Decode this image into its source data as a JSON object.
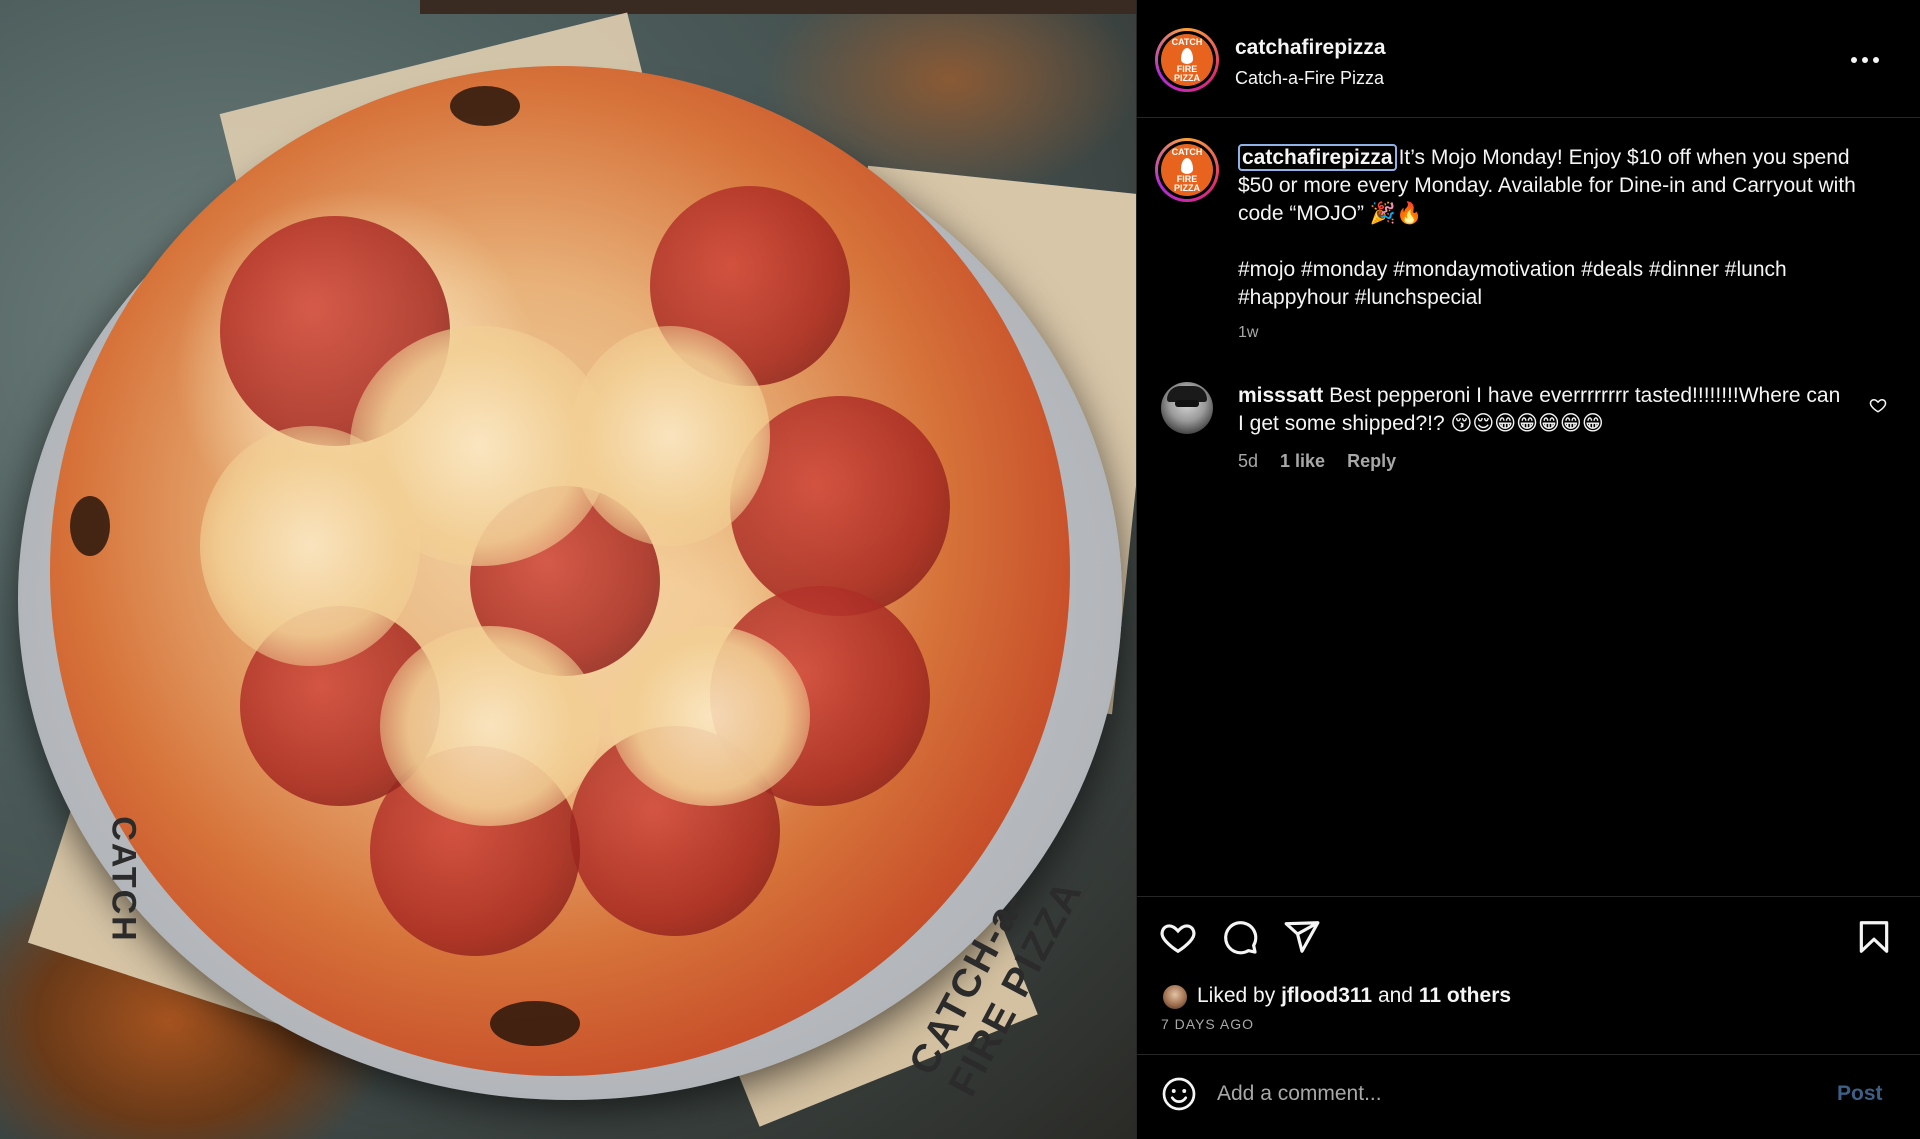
{
  "post": {
    "username": "catchafirepizza",
    "display_name": "Catch-a-Fire Pizza",
    "avatar_logo_lines": [
      "CATCH",
      "FIRE",
      "PIZZA"
    ],
    "caption_text": "It’s Mojo Monday! Enjoy $10 off when you spend $50 or more every Monday. Available for Dine-in and Carryout with code “MOJO” 🎉🔥",
    "hashtags": "#mojo #monday #mondaymotivation #deals #dinner #lunch #happyhour #lunchspecial",
    "caption_time": "1w",
    "photo_brand_text": "CATCH-a-FIRE PIZZA",
    "photo_brand_text_left": "CATCH"
  },
  "comments": [
    {
      "username": "misssatt",
      "text": "Best pepperoni I have everrrrrrrr tasted!!!!!!!!Where can I get some shipped?!? 😚😌😁😁😁😁😁",
      "time": "5d",
      "likes": "1 like",
      "reply_label": "Reply"
    }
  ],
  "likes": {
    "prefix": "Liked by",
    "user": "jflood311",
    "joiner": "and",
    "others": "11 others"
  },
  "post_age": "7 DAYS AGO",
  "comment_box": {
    "placeholder": "Add a comment...",
    "post_label": "Post"
  },
  "icons": {
    "more": "more-options-icon",
    "like": "heart-icon",
    "comment": "comment-icon",
    "share": "share-icon",
    "save": "bookmark-icon",
    "emoji": "emoji-icon",
    "comment_like": "heart-outline-icon"
  },
  "colors": {
    "background": "#000000",
    "text": "#f5f5f5",
    "muted": "#a8a8a8",
    "post_button": "#3e5f85",
    "brand_orange": "#e8641e"
  }
}
